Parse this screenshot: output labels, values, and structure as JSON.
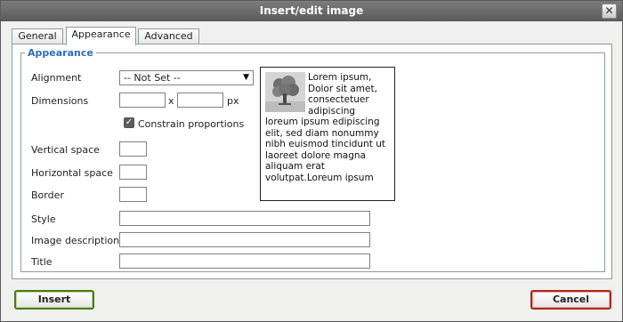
{
  "dialog": {
    "title": "Insert/edit image",
    "close_glyph": "✕"
  },
  "tabs": [
    {
      "label": "General",
      "active": false
    },
    {
      "label": "Appearance",
      "active": true
    },
    {
      "label": "Advanced",
      "active": false
    }
  ],
  "appearance": {
    "legend": "Appearance",
    "alignment_label": "Alignment",
    "alignment_value": "-- Not Set --",
    "dimensions_label": "Dimensions",
    "width_value": "",
    "height_value": "",
    "dimension_separator": "x",
    "dimension_unit": "px",
    "constrain_label": "Constrain proportions",
    "constrain_checked": true,
    "vspace_label": "Vertical space",
    "vspace_value": "",
    "hspace_label": "Horizontal space",
    "hspace_value": "",
    "border_label": "Border",
    "border_value": "",
    "style_label": "Style",
    "style_value": "",
    "description_label": "Image description",
    "description_value": "",
    "title_label": "Title",
    "title_value": ""
  },
  "preview": {
    "text": "Lorem ipsum, Dolor sit amet, consectetuer adipiscing loreum ipsum edipiscing elit, sed diam nonummy nibh euismod tincidunt ut laoreet dolore magna aliquam erat volutpat.Loreum ipsum"
  },
  "footer": {
    "insert_label": "Insert",
    "cancel_label": "Cancel"
  },
  "colors": {
    "legend_blue": "#2b6fb6",
    "insert_border": "#4b7a1b",
    "cancel_border": "#b0261a"
  }
}
